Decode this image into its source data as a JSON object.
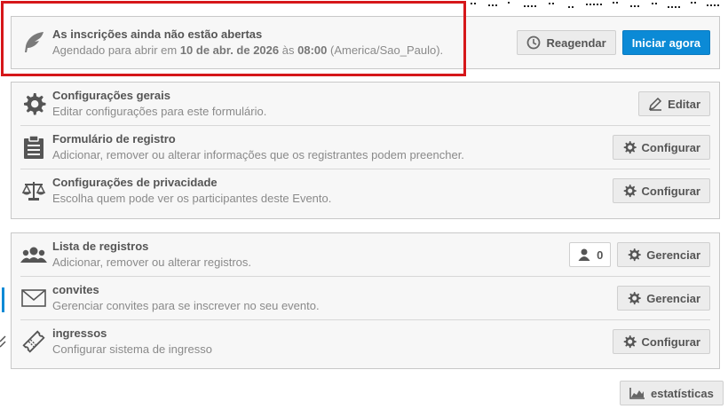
{
  "banner": {
    "title": "As inscrições ainda não estão abertas",
    "sub_prefix": "Agendado para abrir em",
    "date": "10 de abr. de 2026",
    "sub_mid": "às",
    "time": "08:00",
    "timezone": "(America/Sao_Paulo).",
    "reschedule_label": "Reagendar",
    "start_label": "Iniciar agora"
  },
  "settings": [
    {
      "title": "Configurações gerais",
      "sub": "Editar configurações para este formulário.",
      "action": "Editar",
      "icon": "gear-icon"
    },
    {
      "title": "Formulário de registro",
      "sub": "Adicionar, remover ou alterar informações que os registrantes podem preencher.",
      "action": "Configurar",
      "icon": "clipboard-icon"
    },
    {
      "title": "Configurações de privacidade",
      "sub": "Escolha quem pode ver os participantes deste Evento.",
      "action": "Configurar",
      "icon": "scales-icon"
    }
  ],
  "registrations": [
    {
      "title": "Lista de registros",
      "sub": "Adicionar, remover ou alterar registros.",
      "count": "0",
      "action": "Gerenciar",
      "icon": "users-icon"
    },
    {
      "title": "convites",
      "sub": "Gerenciar convites para se inscrever no seu evento.",
      "action": "Gerenciar",
      "icon": "envelope-icon"
    },
    {
      "title": "ingressos",
      "sub": "Configurar sistema de ingresso",
      "action": "Configurar",
      "icon": "ticket-icon"
    }
  ],
  "stats_label": "estatísticas",
  "colors": {
    "primary": "#0b8ad6",
    "highlight": "#d6171a",
    "panel": "#f7f7f7"
  }
}
